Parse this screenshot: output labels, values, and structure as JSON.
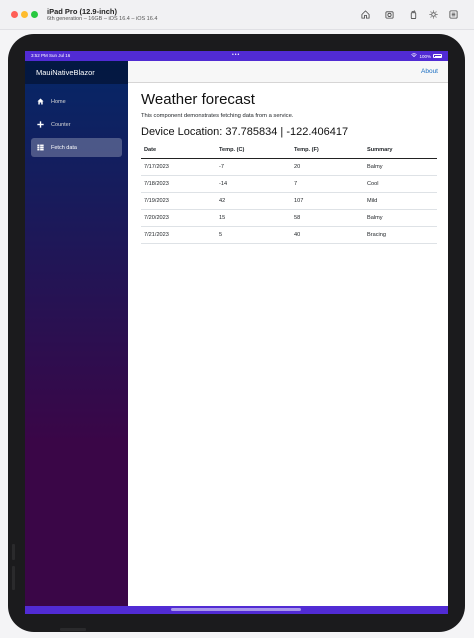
{
  "simulator": {
    "title": "iPad Pro (12.9-inch)",
    "subtitle": "6th generation – 16GB – iOS 16.4 – iOS 16.4"
  },
  "status_bar": {
    "time": "3:52 PM   Sun Jul 16",
    "dots": "•••",
    "battery": "100%"
  },
  "sidebar": {
    "brand": "MauiNativeBlazor",
    "items": [
      {
        "label": "Home",
        "icon": "home-icon",
        "active": false
      },
      {
        "label": "Counter",
        "icon": "plus-icon",
        "active": false
      },
      {
        "label": "Fetch data",
        "icon": "list-icon",
        "active": true
      }
    ]
  },
  "top_row": {
    "about": "About"
  },
  "page": {
    "title": "Weather forecast",
    "intro": "This component demonstrates fetching data from a service.",
    "location": "Device Location: 37.785834 | -122.406417"
  },
  "table": {
    "headers": [
      "Date",
      "Temp. (C)",
      "Temp. (F)",
      "Summary"
    ],
    "rows": [
      [
        "7/17/2023",
        "-7",
        "20",
        "Balmy"
      ],
      [
        "7/18/2023",
        "-14",
        "7",
        "Cool"
      ],
      [
        "7/19/2023",
        "42",
        "107",
        "Mild"
      ],
      [
        "7/20/2023",
        "15",
        "58",
        "Balmy"
      ],
      [
        "7/21/2023",
        "5",
        "40",
        "Bracing"
      ]
    ]
  },
  "colors": {
    "accent": "#512bd4",
    "link": "#1b6ec2",
    "sidebar_top": "#052767",
    "sidebar_bottom": "#3a0647"
  }
}
